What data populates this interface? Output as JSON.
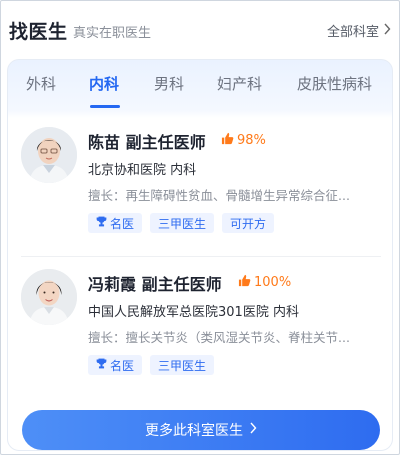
{
  "header": {
    "title": "找医生",
    "subtitle": "真实在职医生",
    "all_depts_label": "全部科室"
  },
  "tabs": [
    {
      "label": "外科",
      "active": false
    },
    {
      "label": "内科",
      "active": true
    },
    {
      "label": "男科",
      "active": false
    },
    {
      "label": "妇产科",
      "active": false
    },
    {
      "label": "皮肤性病科",
      "active": false
    }
  ],
  "doctors": [
    {
      "name_title": "陈苗 副主任医师",
      "rating": "98%",
      "hospital": "北京协和医院 内科",
      "specialty": "擅长：再生障碍性贫血、骨髓增生异常综合征...",
      "tags": [
        "名医",
        "三甲医生",
        "可开方"
      ]
    },
    {
      "name_title": "冯莉霞 副主任医师",
      "rating": "100%",
      "hospital": "中国人民解放军总医院301医院 内科",
      "specialty": "擅长：擅长关节炎（类风湿关节炎、脊柱关节...",
      "tags": [
        "名医",
        "三甲医生"
      ]
    }
  ],
  "more_button_label": "更多此科室医生",
  "colors": {
    "accent": "#2468f2",
    "rating": "#ff7a1a",
    "tag_bg": "#eef3ff"
  },
  "icons": {
    "rating": "thumbs-up-icon",
    "badge": "trophy-icon",
    "chevron": "chevron-right-icon"
  }
}
